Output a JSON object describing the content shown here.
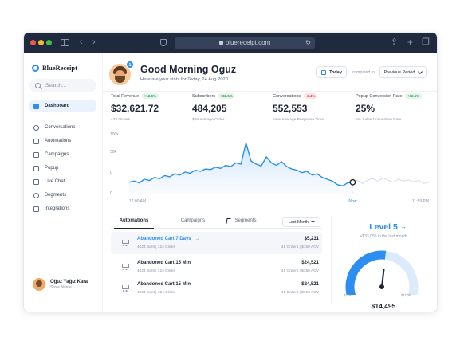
{
  "browser": {
    "url": "bluereceipt.com",
    "icons": [
      "sidebar-toggle-icon",
      "back-icon",
      "forward-icon",
      "shield-icon",
      "lock-icon",
      "reload-icon",
      "share-icon",
      "new-tab-icon",
      "tabs-icon"
    ]
  },
  "sidebar": {
    "brand": "BlueReceipt",
    "search_placeholder": "Search...",
    "items": [
      {
        "label": "Dashboard",
        "icon": "dashboard-icon",
        "active": true
      },
      {
        "label": "Conversations",
        "icon": "chat-bubble-icon"
      },
      {
        "label": "Automations",
        "icon": "automation-icon"
      },
      {
        "label": "Campaigns",
        "icon": "campaign-icon"
      },
      {
        "label": "Popup",
        "icon": "popup-icon"
      },
      {
        "label": "Live Chat",
        "icon": "live-chat-icon"
      },
      {
        "label": "Segments",
        "icon": "segments-icon"
      },
      {
        "label": "Integrations",
        "icon": "integrations-icon"
      }
    ],
    "user": {
      "name": "Oğuz Yağız Kara",
      "role": "Store Name"
    }
  },
  "header": {
    "notification_count": "1",
    "greeting": "Good Morning Oguz",
    "subtitle": "Here are your stats for Today, 24 Aug 2020",
    "today_label": "Today",
    "compared_label": "compared to",
    "period_label": "Previous Period"
  },
  "stats": [
    {
      "label": "Total Revenue",
      "change": "+12.5%",
      "trend": "up",
      "value": "$32,621.72",
      "sub": "433 Orders"
    },
    {
      "label": "Subscribers",
      "change": "+32.5%",
      "trend": "up",
      "value": "484,205",
      "sub": "$56 Average Order"
    },
    {
      "label": "Conversations",
      "change": "-3.4%",
      "trend": "down",
      "value": "552,553",
      "sub": "5min Average Response Time"
    },
    {
      "label": "Popup Conversion Rate",
      "change": "+32.5%",
      "trend": "up",
      "value": "25%",
      "sub": "5% Sales Conversion Rate"
    }
  ],
  "chart_data": {
    "type": "line",
    "y_tick_labels": [
      "100k",
      "50k",
      "0",
      "0"
    ],
    "ylim": [
      0,
      100
    ],
    "x_labels": [
      "17:00 AM",
      "Now",
      "11:59 PM"
    ],
    "grid": false,
    "current_x": 0.5,
    "series": [
      {
        "values": [
          20,
          22,
          19,
          25,
          23,
          28,
          26,
          31,
          29,
          34,
          32,
          37,
          35,
          40,
          38,
          42,
          41,
          45,
          43,
          48,
          46,
          52,
          50,
          85,
          55,
          50,
          47,
          62,
          52,
          48,
          54,
          46,
          42,
          40,
          36,
          38,
          32,
          34,
          28,
          25,
          22,
          16,
          14,
          19,
          20
        ],
        "color": "#2c8ef0"
      },
      {
        "values": [
          null,
          null,
          null,
          null,
          null,
          null,
          null,
          null,
          null,
          null,
          null,
          null,
          null,
          null,
          null,
          null,
          null,
          null,
          null,
          null,
          null,
          null,
          null,
          null,
          null,
          null,
          null,
          null,
          null,
          null,
          null,
          null,
          null,
          null,
          null,
          null,
          null,
          null,
          null,
          null,
          null,
          null,
          null,
          null,
          20,
          23,
          18,
          24,
          26,
          22,
          27,
          23,
          20,
          25,
          22,
          24,
          21,
          23,
          18,
          20
        ],
        "color": "#d5dbe4"
      }
    ]
  },
  "table": {
    "tabs": [
      "Automations",
      "Campaigns",
      "Segments"
    ],
    "active_tab": "Automations",
    "period": "Last Month",
    "rows": [
      {
        "title": "Abandoned Cart 7 Days",
        "arrow": "→",
        "meta": "4024 Sent | 124 Clicks",
        "amount": "$5,231",
        "orders": "41 Orders | $150 AOV"
      },
      {
        "title": "Abandoned Cart 15 Min",
        "arrow": "",
        "meta": "4024 Sent | 124 Clicks",
        "amount": "$24,521",
        "orders": "41 Orders | $150 AOV"
      },
      {
        "title": "Abandoned Cart 15 Min",
        "arrow": "",
        "meta": "4024 Sent | 124 Clicks",
        "amount": "$24,521",
        "orders": "41 Orders | $150 AOV"
      }
    ]
  },
  "level": {
    "title": "Level 5",
    "subtitle": "+$33,050 in the last month",
    "gauge_min": "$10k",
    "gauge_max": "$100k",
    "gauge_fraction": 0.53,
    "value": "$14,495",
    "accent": "#2c8ef0"
  }
}
